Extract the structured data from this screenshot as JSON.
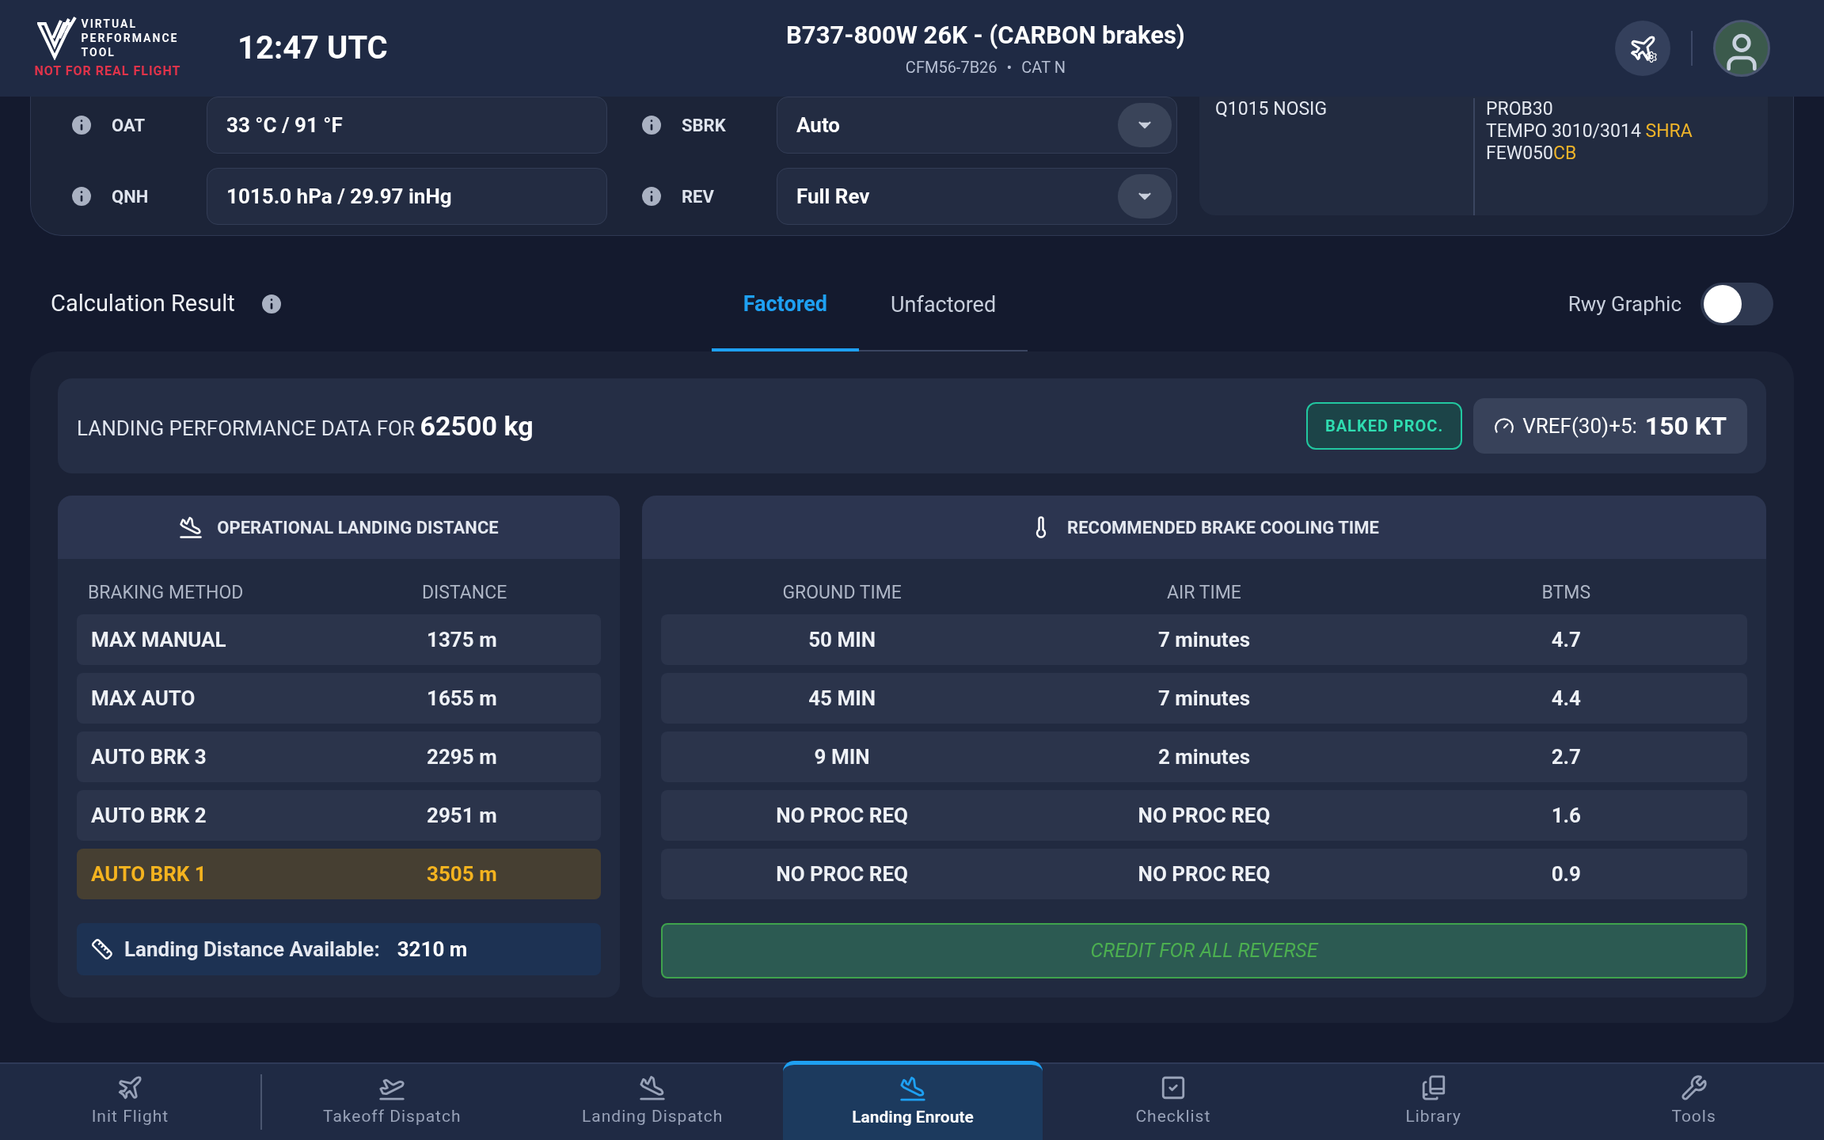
{
  "header": {
    "logo_lines": [
      "VIRTUAL",
      "PERFORMANCE",
      "TOOL"
    ],
    "warning": "NOT FOR REAL FLIGHT",
    "time": "12:47 UTC",
    "aircraft": "B737-800W 26K - (CARBON brakes)",
    "engine": "CFM56-7B26",
    "category": "CAT N",
    "separator": "•"
  },
  "conditions": {
    "rows": [
      {
        "label": "OAT",
        "value": "33 °C / 91 °F",
        "kind": "text"
      },
      {
        "label": "SBRK",
        "value": "Auto",
        "kind": "select"
      },
      {
        "label": "QNH",
        "value": "1015.0 hPa / 29.97 inHg",
        "kind": "text"
      },
      {
        "label": "REV",
        "value": "Full Rev",
        "kind": "select"
      }
    ],
    "weather_columns": [
      [
        [
          {
            "text": "Q1015 NOSIG",
            "kind": "plain"
          }
        ]
      ],
      [
        [
          {
            "text": "PROB30",
            "kind": "plain"
          }
        ],
        [
          {
            "text": "TEMPO 3010/3014 ",
            "kind": "plain"
          },
          {
            "text": "SHRA",
            "kind": "significant"
          }
        ],
        [
          {
            "text": "FEW050",
            "kind": "plain"
          },
          {
            "text": "CB",
            "kind": "significant"
          }
        ]
      ]
    ]
  },
  "result": {
    "title": "Calculation Result",
    "tabs": [
      {
        "label": "Factored",
        "selected": true
      },
      {
        "label": "Unfactored",
        "selected": false
      }
    ],
    "toggle": {
      "label": "Rwy Graphic",
      "on": false
    },
    "summary": {
      "prefix": "LANDING PERFORMANCE DATA FOR",
      "weight": "62500 kg",
      "badge": "BALKED PROC.",
      "vref_label": "VREF(30)+5:",
      "vref_value": "150 KT"
    },
    "distance": {
      "title": "OPERATIONAL LANDING DISTANCE",
      "columns": [
        "BRAKING METHOD",
        "DISTANCE"
      ],
      "rows": [
        {
          "method": "MAX MANUAL",
          "distance": "1375 m",
          "selected": false
        },
        {
          "method": "MAX AUTO",
          "distance": "1655 m",
          "selected": false
        },
        {
          "method": "AUTO BRK 3",
          "distance": "2295 m",
          "selected": false
        },
        {
          "method": "AUTO BRK 2",
          "distance": "2951 m",
          "selected": false
        },
        {
          "method": "AUTO BRK 1",
          "distance": "3505 m",
          "selected": true
        }
      ],
      "available_label": "Landing Distance Available:",
      "available_value": "3210 m"
    },
    "cooling": {
      "title": "RECOMMENDED BRAKE COOLING TIME",
      "columns": [
        "GROUND TIME",
        "AIR TIME",
        "BTMS"
      ],
      "rows": [
        [
          "50 MIN",
          "7 minutes",
          "4.7"
        ],
        [
          "45 MIN",
          "7 minutes",
          "4.4"
        ],
        [
          "9 MIN",
          "2 minutes",
          "2.7"
        ],
        [
          "NO PROC REQ",
          "NO PROC REQ",
          "1.6"
        ],
        [
          "NO PROC REQ",
          "NO PROC REQ",
          "0.9"
        ]
      ],
      "note": "CREDIT FOR ALL REVERSE"
    }
  },
  "nav": [
    {
      "label": "Init Flight",
      "kind": "plane",
      "selected": false
    },
    {
      "label": "Takeoff Dispatch",
      "kind": "takeoff",
      "selected": false
    },
    {
      "label": "Landing Dispatch",
      "kind": "landing",
      "selected": false
    },
    {
      "label": "Landing Enroute",
      "kind": "landing",
      "selected": true
    },
    {
      "label": "Checklist",
      "kind": "check",
      "selected": false
    },
    {
      "label": "Library",
      "kind": "books",
      "selected": false
    },
    {
      "label": "Tools",
      "kind": "tools",
      "selected": false
    }
  ]
}
